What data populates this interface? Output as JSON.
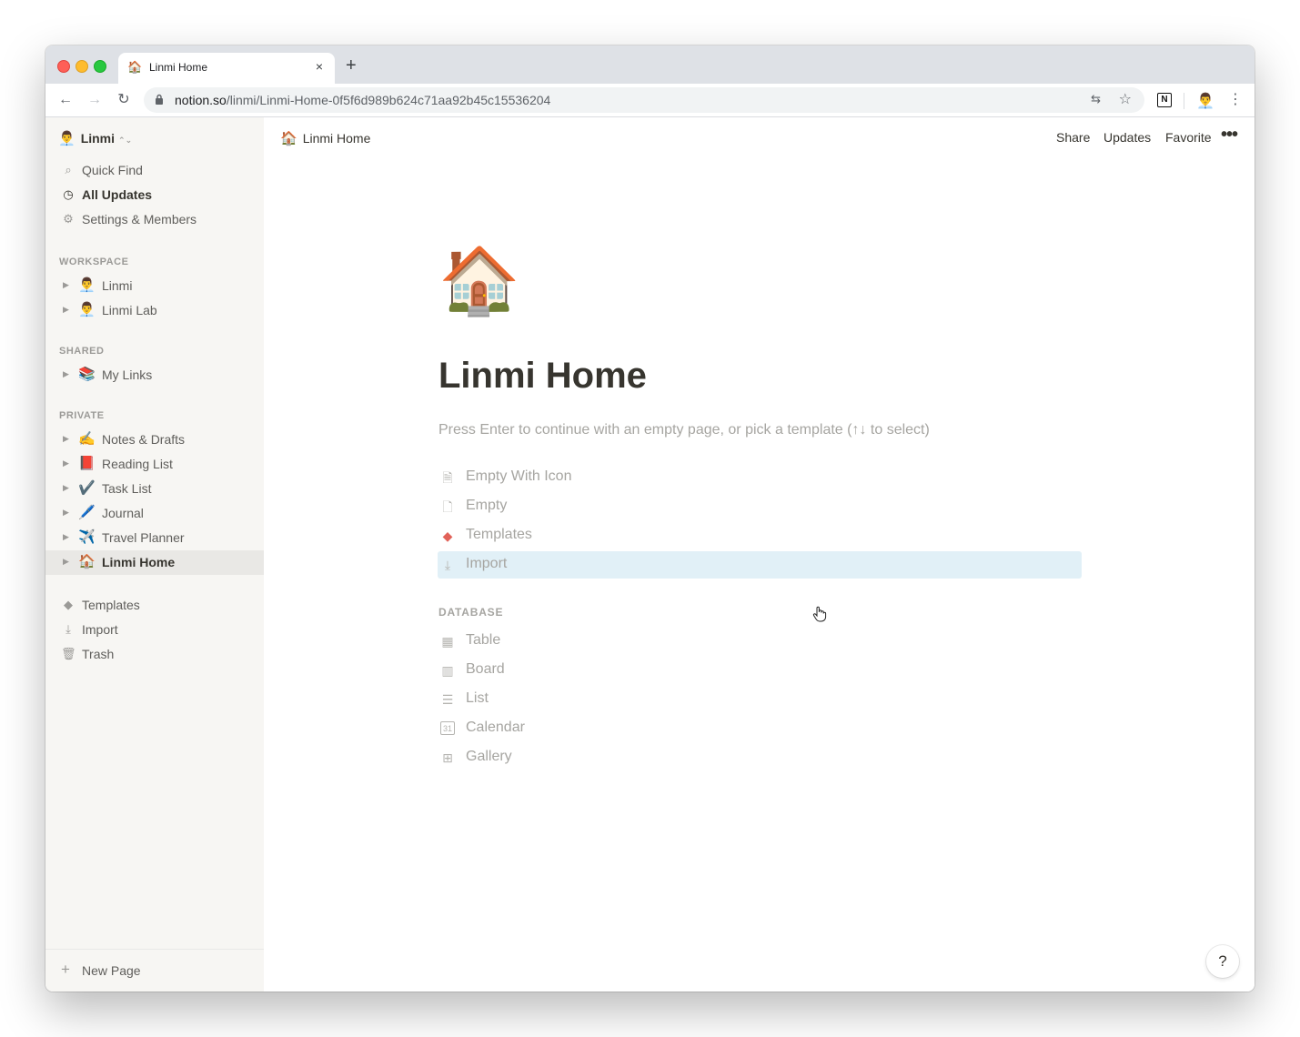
{
  "browser": {
    "tab": {
      "favicon": "🏠",
      "title": "Linmi Home",
      "close": "×"
    },
    "new_tab": "+",
    "nav": {
      "back": "←",
      "forward": "→",
      "reload": "↻"
    },
    "url_host": "notion.so",
    "url_path": "/linmi/Linmi-Home-0f5f6d989b624c71aa92b45c15536204",
    "translate": "⇆",
    "star": "☆",
    "extension_label": "N",
    "profile_emoji": "👨‍💼",
    "menu": "⋮"
  },
  "sidebar": {
    "workspace": {
      "emoji": "👨‍💼",
      "name": "Linmi",
      "chevron": "⌃⌄"
    },
    "top_items": [
      {
        "icon": "⌕",
        "label": "Quick Find"
      },
      {
        "icon": "◷",
        "label": "All Updates"
      },
      {
        "icon": "⚙",
        "label": "Settings & Members"
      }
    ],
    "workspace_header": "WORKSPACE",
    "workspace_pages": [
      {
        "emoji": "👨‍💼",
        "label": "Linmi"
      },
      {
        "emoji": "👨‍💼",
        "label": "Linmi Lab"
      }
    ],
    "shared_header": "SHARED",
    "shared_pages": [
      {
        "emoji": "📚",
        "label": "My Links"
      }
    ],
    "private_header": "PRIVATE",
    "private_pages": [
      {
        "emoji": "✍️",
        "label": "Notes & Drafts"
      },
      {
        "emoji": "📕",
        "label": "Reading List"
      },
      {
        "emoji": "✔️",
        "label": "Task List"
      },
      {
        "emoji": "🖊️",
        "label": "Journal"
      },
      {
        "emoji": "✈️",
        "label": "Travel Planner"
      },
      {
        "emoji": "🏠",
        "label": "Linmi Home"
      }
    ],
    "bottom_items": [
      {
        "icon": "◆",
        "label": "Templates"
      },
      {
        "icon": "⤓",
        "label": "Import"
      },
      {
        "icon": "🗑",
        "label": "Trash"
      }
    ],
    "new_page": {
      "icon": "+",
      "label": "New Page"
    },
    "triangle": "▶"
  },
  "main": {
    "breadcrumb": {
      "emoji": "🏠",
      "title": "Linmi Home"
    },
    "actions": {
      "share": "Share",
      "updates": "Updates",
      "favorite": "Favorite",
      "more": "•••"
    },
    "page_icon": "🏠",
    "title": "Linmi Home",
    "hint": "Press Enter to continue with an empty page, or pick a template (↑↓ to select)",
    "templates": [
      {
        "icon": "🗎",
        "label": "Empty With Icon"
      },
      {
        "icon": "🗋",
        "label": "Empty"
      },
      {
        "icon": "◆",
        "label": "Templates"
      },
      {
        "icon": "⤓",
        "label": "Import"
      }
    ],
    "database_header": "DATABASE",
    "database_items": [
      {
        "icon": "▦",
        "label": "Table"
      },
      {
        "icon": "▥",
        "label": "Board"
      },
      {
        "icon": "☰",
        "label": "List"
      },
      {
        "icon": "31",
        "label": "Calendar"
      },
      {
        "icon": "⊞",
        "label": "Gallery"
      }
    ],
    "help": "?"
  },
  "colors": {
    "sidebar_bg": "#f7f6f3",
    "text": "#37352f",
    "muted": "#a6a5a1",
    "highlight": "#e1f0f7"
  }
}
